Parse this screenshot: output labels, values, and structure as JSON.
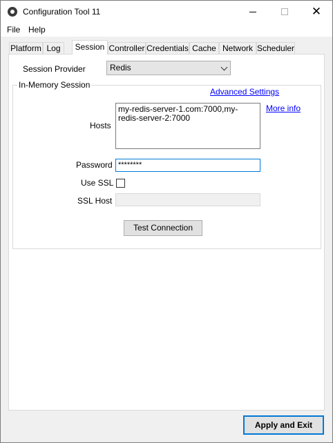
{
  "window": {
    "title": "Configuration Tool 11",
    "close_glyph": "✕"
  },
  "menu": {
    "file": "File",
    "help": "Help"
  },
  "tabs": [
    "Platform",
    "Log",
    "Session",
    "Controller",
    "Credentials",
    "Cache",
    "Network",
    "Scheduler"
  ],
  "session": {
    "provider_label": "Session Provider",
    "provider_value": "Redis",
    "group_title": "In-Memory Session",
    "advanced_settings": "Advanced Settings",
    "more_info": "More info",
    "hosts_label": "Hosts",
    "hosts_value": "my-redis-server-1.com:7000,my-redis-server-2:7000",
    "password_label": "Password",
    "password_value": "********",
    "use_ssl_label": "Use SSL",
    "use_ssl_checked": false,
    "ssl_host_label": "SSL Host",
    "ssl_host_value": "",
    "test_connection": "Test Connection"
  },
  "footer": {
    "apply_exit": "Apply and Exit"
  }
}
